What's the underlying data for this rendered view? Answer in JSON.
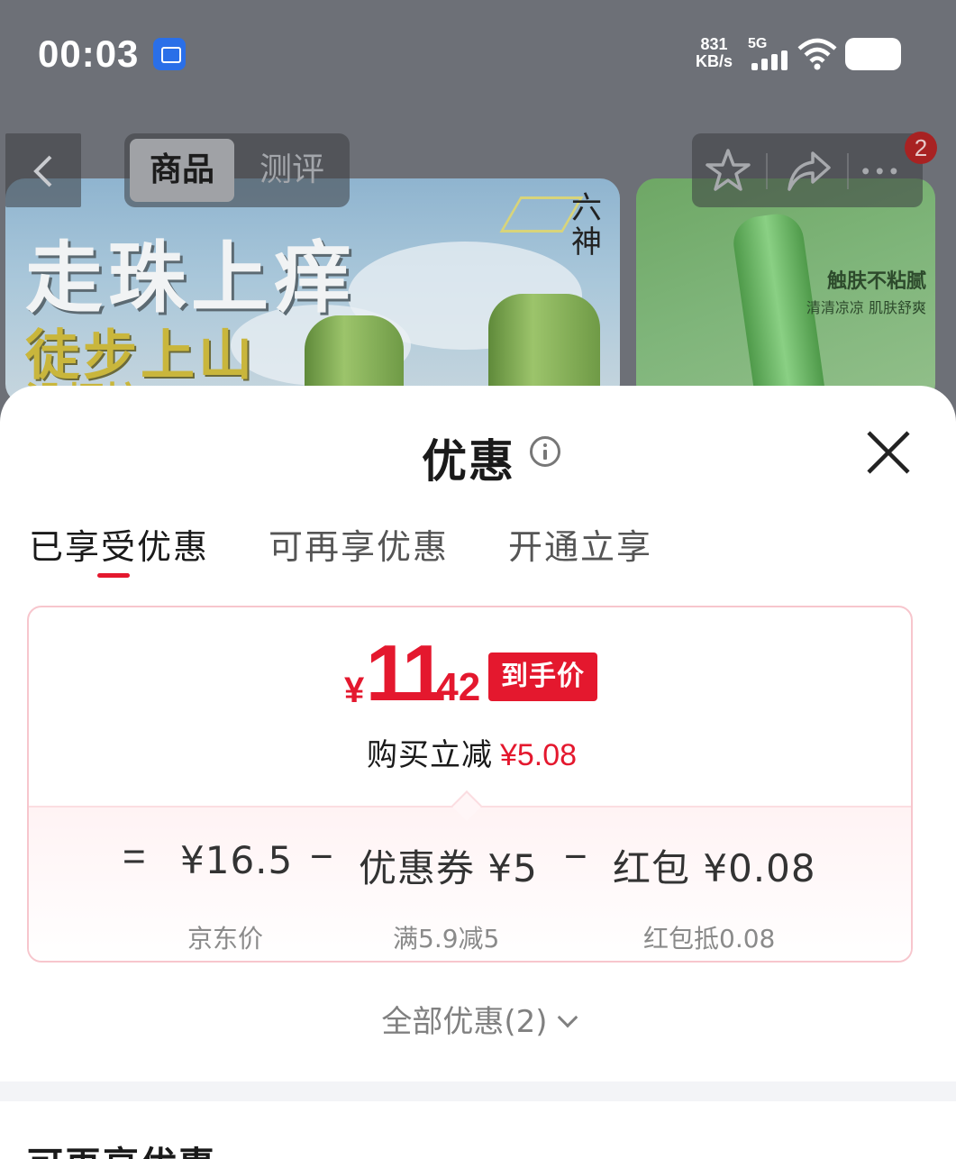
{
  "status_bar": {
    "time": "00:03",
    "net_speed_value": "831",
    "net_speed_unit": "KB/s",
    "network_type": "5G",
    "icons": [
      "screen-record-icon",
      "signal-icon",
      "wifi-icon",
      "battery-icon"
    ]
  },
  "background_page": {
    "tabs": [
      "商品",
      "测评"
    ],
    "active_tab": "商品",
    "notification_count": "2",
    "banner_main": {
      "headline": "走珠上痒",
      "subline": "徒步上山",
      "subline2": "没烦恼",
      "brand": "六神"
    },
    "banner_side": {
      "title": "触肤不粘腻",
      "subtitle": "清清凉凉 肌肤舒爽"
    },
    "action_icons": [
      "star-icon",
      "share-icon",
      "more-icon"
    ]
  },
  "sheet": {
    "title": "优惠",
    "tabs": [
      {
        "label": "已享受优惠",
        "active": true
      },
      {
        "label": "可再享优惠",
        "active": false
      },
      {
        "label": "开通立享",
        "active": false
      }
    ],
    "price_card": {
      "currency": "¥",
      "price_integer": "11",
      "price_decimal": ".42",
      "tag": "到手价",
      "saving_label": "购买立减",
      "saving_amount": "¥5.08",
      "breakdown": {
        "equals": "=",
        "minus": "−",
        "items": [
          {
            "value": "¥16.5",
            "sub": "京东价"
          },
          {
            "value": "优惠券 ¥5",
            "sub": "满5.9减5"
          },
          {
            "value": "红包 ¥0.08",
            "sub": "红包抵0.08"
          }
        ]
      }
    },
    "all_offers_label": "全部优惠(2)",
    "next_section_title": "可再享优惠"
  },
  "colors": {
    "accent_red": "#e4182e",
    "card_border": "#f7c6cd",
    "overlay": "#6d7077"
  }
}
